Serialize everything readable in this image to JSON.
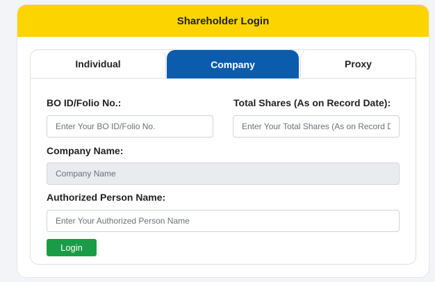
{
  "header": {
    "title": "Shareholder Login"
  },
  "tabs": [
    {
      "label": "Individual",
      "active": false
    },
    {
      "label": "Company",
      "active": true
    },
    {
      "label": "Proxy",
      "active": false
    }
  ],
  "form": {
    "bo_label": "BO ID/Folio No.:",
    "bo_placeholder": "Enter Your BO ID/Folio No.",
    "shares_label": "Total Shares (As on Record Date):",
    "shares_placeholder": "Enter Your Total Shares (As on Record Date)",
    "company_label": "Company Name:",
    "company_placeholder": "Company Name",
    "auth_label": "Authorized Person Name:",
    "auth_placeholder": "Enter Your Authorized Person Name",
    "login_label": "Login"
  },
  "colors": {
    "header_bg": "#fcd400",
    "active_tab_bg": "#0b5cad",
    "login_button_bg": "#1a9c46"
  }
}
